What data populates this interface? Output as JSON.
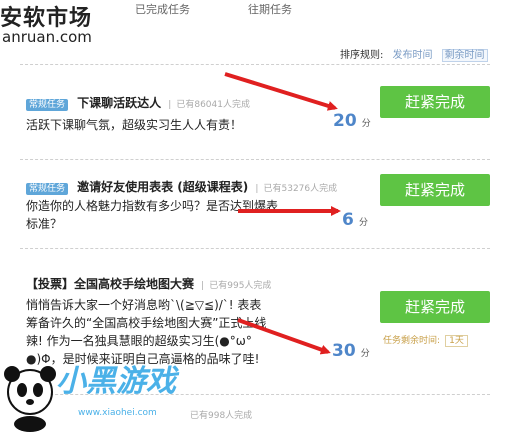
{
  "watermark": {
    "title": "安软市场",
    "url": "anruan.com"
  },
  "tabs": [
    "已完成任务",
    "往期任务"
  ],
  "sort": {
    "label": "排序规则:",
    "options": [
      "发布时间",
      "剩余时间"
    ],
    "active_index": 1
  },
  "tasks": [
    {
      "badge": "常规任务",
      "title": "下课聊活跃达人",
      "count": "已有86041人完成",
      "desc": [
        "活跃下课聊气氛，超级实习生人人有责！"
      ],
      "points": "20",
      "unit": "分",
      "button": "赶紧完成"
    },
    {
      "badge": "常规任务",
      "title": "邀请好友使用表表 (超级课程表)",
      "count": "已有53276人完成",
      "desc": [
        "你造你的人格魅力指数有多少吗？是否达到爆表",
        "标准？"
      ],
      "points": "6",
      "unit": "分",
      "button": "赶紧完成"
    },
    {
      "title": "【投票】全国高校手绘地图大赛",
      "count": "已有995人完成",
      "desc": [
        "悄悄告诉大家一个好消息哟`\\(≧▽≦)/`! 表表",
        "筹备许久的“全国高校手绘地图大赛”正式上线",
        "辣! 作为一名独具慧眼的超级实习生(●°ω°",
        "●)Φ，是时候来证明自己高逼格的品味了哇!"
      ],
      "points": "30",
      "unit": "分",
      "button": "赶紧完成",
      "remain_label": "任务剩余时间:",
      "remain_value": "1天"
    }
  ],
  "last_count": "已有998人完成",
  "bottom_logo": {
    "text": "小黑游戏",
    "url": "www.xiaohei.com"
  },
  "colors": {
    "green": "#5ec444",
    "blue": "#4f86c9",
    "badge": "#5fa6d9",
    "arrow": "#e02020"
  }
}
